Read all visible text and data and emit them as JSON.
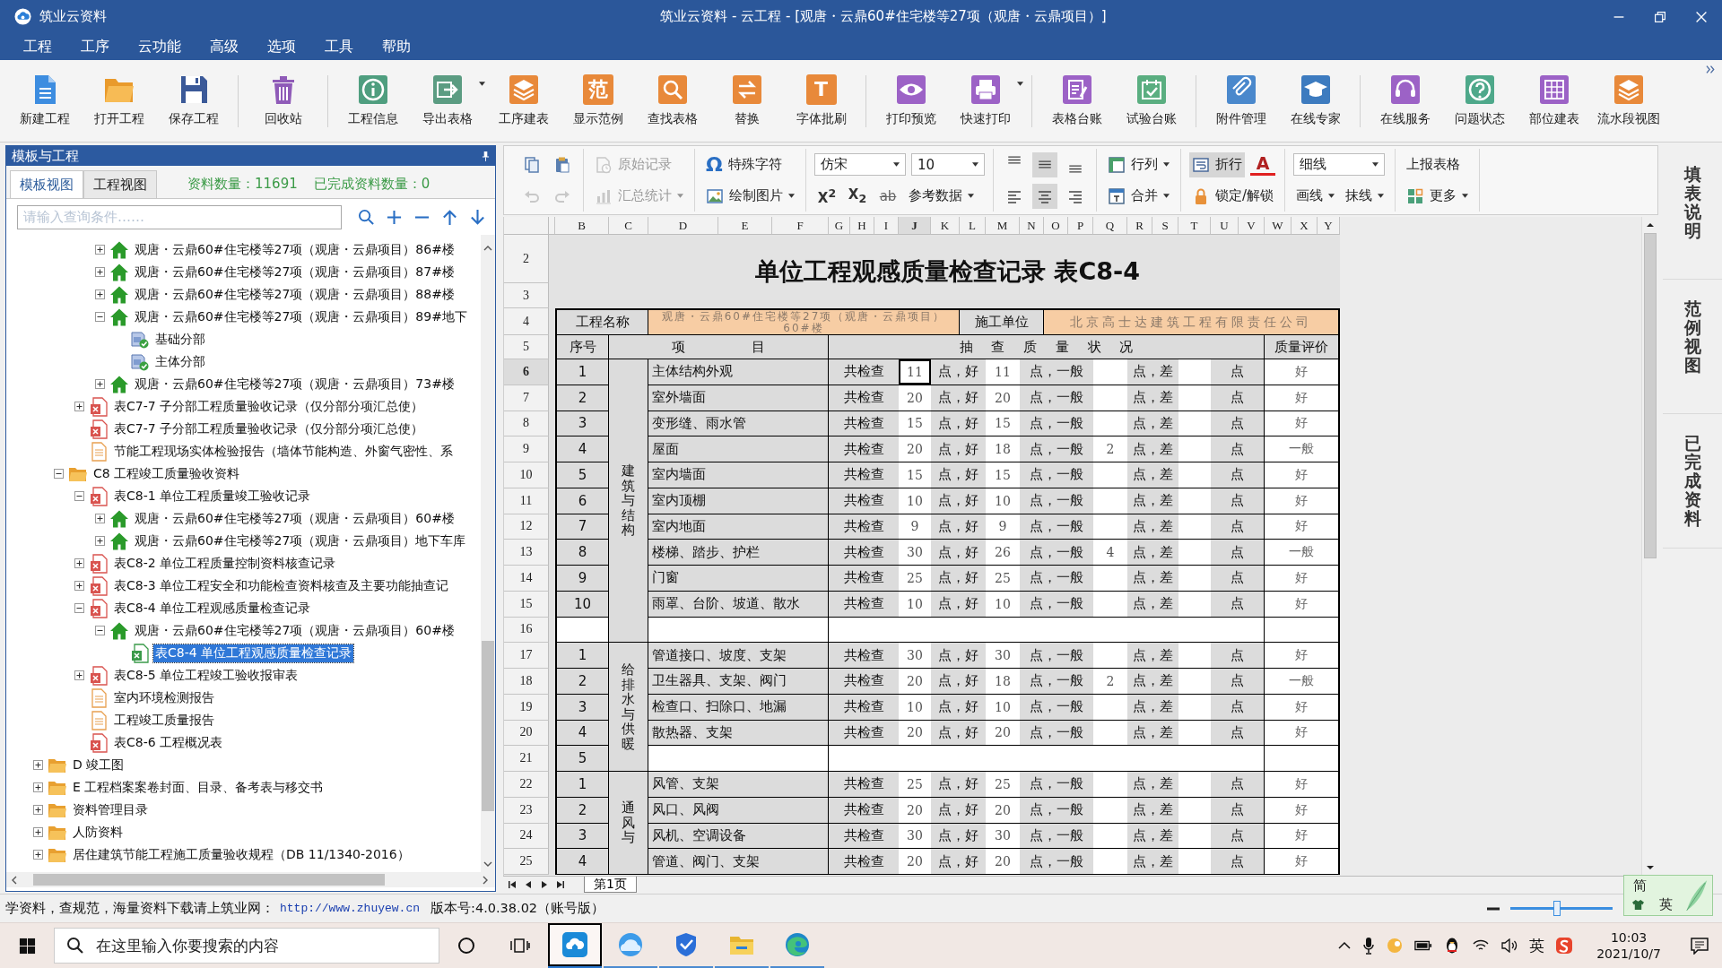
{
  "window": {
    "app_name": "筑业云资料",
    "title": "筑业云资料 - 云工程 - [观唐・云鼎60#住宅楼等27项（观唐・云鼎项目）]"
  },
  "menu": [
    "工程",
    "工序",
    "云功能",
    "高级",
    "选项",
    "工具",
    "帮助"
  ],
  "toolbar": {
    "groups": [
      [
        {
          "label": "新建工程",
          "menu": false
        },
        {
          "label": "打开工程",
          "menu": false
        },
        {
          "label": "保存工程",
          "menu": false
        }
      ],
      [
        {
          "label": "回收站",
          "menu": false
        }
      ],
      [
        {
          "label": "工程信息",
          "menu": false
        },
        {
          "label": "导出表格",
          "menu": true
        },
        {
          "label": "工序建表",
          "menu": false
        },
        {
          "label": "显示范例",
          "glyph": "范",
          "menu": false
        },
        {
          "label": "查找表格",
          "menu": false
        },
        {
          "label": "替换",
          "menu": false
        },
        {
          "label": "字体批刷",
          "glyph": "T",
          "menu": false
        }
      ],
      [
        {
          "label": "打印预览",
          "menu": false
        },
        {
          "label": "快速打印",
          "menu": true
        }
      ],
      [
        {
          "label": "表格台账",
          "menu": false
        },
        {
          "label": "试验台账",
          "menu": false
        }
      ],
      [
        {
          "label": "附件管理",
          "menu": false
        },
        {
          "label": "在线专家",
          "menu": false
        }
      ],
      [
        {
          "label": "在线服务",
          "menu": false
        },
        {
          "label": "问题状态",
          "menu": false
        },
        {
          "label": "部位建表",
          "menu": false
        },
        {
          "label": "流水段视图",
          "menu": false
        }
      ]
    ]
  },
  "format_toolbar": [
    {
      "top": [
        {
          "kind": "tool",
          "disabled": false,
          "pressed": false
        },
        {
          "kind": "tool",
          "disabled": false,
          "pressed": false
        }
      ],
      "bottom": [
        {
          "kind": "tool",
          "disabled": true,
          "pressed": false
        },
        {
          "kind": "tool",
          "disabled": true,
          "pressed": false
        }
      ]
    },
    {
      "top": [
        {
          "kind": "button",
          "label": "原始记录",
          "disabled": true,
          "pressed": false,
          "menu": false
        }
      ],
      "bottom": [
        {
          "kind": "button",
          "label": "汇总统计",
          "disabled": true,
          "pressed": false,
          "menu": true
        }
      ]
    },
    {
      "top": [
        {
          "kind": "button",
          "glyph": "Ω",
          "label": "特殊字符",
          "disabled": false,
          "pressed": false,
          "menu": false
        }
      ],
      "bottom": [
        {
          "kind": "button",
          "label": "绘制图片",
          "disabled": false,
          "pressed": false,
          "menu": true
        }
      ]
    },
    {
      "top": [
        {
          "kind": "dropdown",
          "value": "仿宋",
          "disabled": false,
          "pressed": false
        },
        {
          "kind": "dropdown",
          "value": "10",
          "disabled": false,
          "pressed": false
        }
      ],
      "bottom": [
        {
          "kind": "glyph",
          "glyph": "X$^{2}$",
          "disabled": false,
          "pressed": false
        },
        {
          "kind": "glyph",
          "glyph": "X$_{2}$",
          "disabled": false,
          "pressed": false
        },
        {
          "kind": "strike",
          "glyph": "ab",
          "disabled": false,
          "pressed": false
        },
        {
          "kind": "text",
          "label": "参考数据",
          "disabled": false,
          "pressed": false,
          "menu": true
        }
      ]
    },
    {
      "top": [
        {
          "kind": "tool",
          "disabled": false,
          "pressed": false
        },
        {
          "kind": "tool",
          "disabled": false,
          "pressed": true
        },
        {
          "kind": "tool",
          "disabled": false,
          "pressed": false
        }
      ],
      "bottom": [
        {
          "kind": "tool",
          "disabled": false,
          "pressed": false
        },
        {
          "kind": "tool",
          "disabled": false,
          "pressed": true
        },
        {
          "kind": "tool",
          "disabled": false,
          "pressed": false
        }
      ]
    },
    {
      "top": [
        {
          "kind": "button",
          "label": "行列",
          "disabled": false,
          "pressed": false,
          "menu": true
        }
      ],
      "bottom": [
        {
          "kind": "button",
          "label": "合并",
          "disabled": false,
          "pressed": false,
          "menu": true
        }
      ]
    },
    {
      "top": [
        {
          "kind": "button",
          "label": "折行",
          "disabled": false,
          "pressed": true,
          "menu": false
        },
        {
          "kind": "font-color",
          "glyph": "A",
          "disabled": false,
          "pressed": false
        }
      ],
      "bottom": [
        {
          "kind": "button",
          "label": "锁定/解锁",
          "disabled": false,
          "pressed": false,
          "menu": false
        }
      ]
    },
    {
      "top": [
        {
          "kind": "dropdown",
          "value": "细线",
          "disabled": false,
          "pressed": false
        }
      ],
      "bottom": [
        {
          "kind": "text",
          "label": "画线",
          "disabled": false,
          "pressed": false,
          "menu": true
        },
        {
          "kind": "text",
          "label": "抹线",
          "disabled": false,
          "pressed": false,
          "menu": true
        }
      ]
    },
    {
      "top": [
        {
          "kind": "text",
          "label": "上报表格",
          "disabled": false,
          "pressed": false,
          "menu": false
        }
      ],
      "bottom": [
        {
          "kind": "button",
          "label": "更多",
          "disabled": false,
          "pressed": false,
          "menu": true
        }
      ]
    }
  ],
  "panel": {
    "title": "模板与工程",
    "tabs": [
      {
        "label": "模板视图",
        "selected": true
      },
      {
        "label": "工程视图",
        "selected": false
      }
    ],
    "stats": [
      "资料数量：11691",
      "已完成资料数量：0"
    ],
    "search": {
      "placeholder": "请输入查询条件……"
    },
    "tree": [
      {
        "children": [
          {
            "children": [
              {
                "children": [
                  {
                    "label": "观唐・云鼎60#住宅楼等27项（观唐・云鼎项目）86#楼",
                    "kind": "building",
                    "expanded": false,
                    "selected": false
                  },
                  {
                    "label": "观唐・云鼎60#住宅楼等27项（观唐・云鼎项目）87#楼",
                    "kind": "building",
                    "expanded": false,
                    "selected": false
                  },
                  {
                    "label": "观唐・云鼎60#住宅楼等27项（观唐・云鼎项目）88#楼",
                    "kind": "building",
                    "expanded": false,
                    "selected": false
                  },
                  {
                    "label": "观唐・云鼎60#住宅楼等27项（观唐・云鼎项目）89#地下",
                    "kind": "building",
                    "expanded": true,
                    "selected": false,
                    "children": [
                      {
                        "label": "基础分部",
                        "kind": "division",
                        "selected": false
                      },
                      {
                        "label": "主体分部",
                        "kind": "division",
                        "selected": false
                      }
                    ]
                  },
                  {
                    "label": "观唐・云鼎60#住宅楼等27项（观唐・云鼎项目）73#楼",
                    "kind": "building",
                    "expanded": false,
                    "selected": false
                  }
                ]
              },
              {
                "label": "表C7-7 子分部工程质量验收记录（仅分部分项汇总使）",
                "kind": "form",
                "expanded": false,
                "selected": false
              },
              {
                "label": "表C7-7 子分部工程质量验收记录（仅分部分项汇总使）",
                "kind": "form",
                "selected": false
              },
              {
                "label": "节能工程现场实体检验报告（墙体节能构造、外窗气密性、系",
                "kind": "report",
                "selected": false
              }
            ]
          },
          {
            "label": "C8 工程竣工质量验收资料",
            "kind": "folder",
            "expanded": true,
            "selected": false,
            "children": [
              {
                "label": "表C8-1 单位工程质量竣工验收记录",
                "kind": "form",
                "expanded": true,
                "selected": false,
                "children": [
                  {
                    "label": "观唐・云鼎60#住宅楼等27项（观唐・云鼎项目）60#楼",
                    "kind": "building",
                    "expanded": false,
                    "selected": false
                  },
                  {
                    "label": "观唐・云鼎60#住宅楼等27项（观唐・云鼎项目）地下车库",
                    "kind": "building",
                    "expanded": false,
                    "selected": false
                  }
                ]
              },
              {
                "label": "表C8-2 单位工程质量控制资料核查记录",
                "kind": "form",
                "expanded": false,
                "selected": false
              },
              {
                "label": "表C8-3 单位工程安全和功能检查资料核查及主要功能抽查记",
                "kind": "form",
                "expanded": false,
                "selected": false
              },
              {
                "label": "表C8-4 单位工程观感质量检查记录",
                "kind": "form",
                "expanded": true,
                "selected": false,
                "children": [
                  {
                    "label": "观唐・云鼎60#住宅楼等27项（观唐・云鼎项目）60#楼",
                    "kind": "building",
                    "expanded": true,
                    "selected": false,
                    "children": [
                      {
                        "label": "表C8-4 单位工程观感质量检查记录",
                        "kind": "sheet",
                        "selected": true
                      }
                    ]
                  }
                ]
              },
              {
                "label": "表C8-5 单位工程竣工验收报审表",
                "kind": "form",
                "expanded": false,
                "selected": false
              },
              {
                "label": "室内环境检测报告",
                "kind": "report",
                "selected": false
              },
              {
                "label": "工程竣工质量报告",
                "kind": "report",
                "selected": false
              },
              {
                "label": "表C8-6 工程概况表",
                "kind": "form",
                "selected": false
              }
            ]
          }
        ]
      },
      {
        "label": "D 竣工图",
        "kind": "folder",
        "expanded": false,
        "selected": false
      },
      {
        "label": "E 工程档案案卷封面、目录、备考表与移交书",
        "kind": "folder",
        "expanded": false,
        "selected": false
      },
      {
        "label": "资料管理目录",
        "kind": "folder",
        "expanded": false,
        "selected": false
      },
      {
        "label": "人防资料",
        "kind": "folder",
        "expanded": false,
        "selected": false
      },
      {
        "label": "居住建筑节能工程施工质量验收规程（DB 11/1340-2016）",
        "kind": "folder",
        "expanded": false,
        "selected": false
      }
    ]
  },
  "sheet": {
    "columns": [
      {
        "label": "B",
        "selected": false
      },
      {
        "label": "C",
        "selected": false
      },
      {
        "label": "D",
        "selected": false
      },
      {
        "label": "E",
        "selected": false
      },
      {
        "label": "F",
        "selected": false
      },
      {
        "label": "G",
        "selected": false
      },
      {
        "label": "H",
        "selected": false
      },
      {
        "label": "I",
        "selected": false
      },
      {
        "label": "J",
        "selected": true
      },
      {
        "label": "K",
        "selected": false
      },
      {
        "label": "L",
        "selected": false
      },
      {
        "label": "M",
        "selected": false
      },
      {
        "label": "N",
        "selected": false
      },
      {
        "label": "O",
        "selected": false
      },
      {
        "label": "P",
        "selected": false
      },
      {
        "label": "Q",
        "selected": false
      },
      {
        "label": "R",
        "selected": false
      },
      {
        "label": "S",
        "selected": false
      },
      {
        "label": "T",
        "selected": false
      },
      {
        "label": "U",
        "selected": false
      },
      {
        "label": "V",
        "selected": false
      },
      {
        "label": "W",
        "selected": false
      },
      {
        "label": "X",
        "selected": false
      },
      {
        "label": "Y",
        "selected": false
      }
    ],
    "row_numbers": [
      {
        "label": "2",
        "selected": false
      },
      {
        "label": "3",
        "selected": false
      },
      {
        "label": "4",
        "selected": false
      },
      {
        "label": "5",
        "selected": false
      },
      {
        "label": "6",
        "selected": true
      },
      {
        "label": "7",
        "selected": false
      },
      {
        "label": "8",
        "selected": false
      },
      {
        "label": "9",
        "selected": false
      },
      {
        "label": "10",
        "selected": false
      },
      {
        "label": "11",
        "selected": false
      },
      {
        "label": "12",
        "selected": false
      },
      {
        "label": "13",
        "selected": false
      },
      {
        "label": "14",
        "selected": false
      },
      {
        "label": "15",
        "selected": false
      },
      {
        "label": "16",
        "selected": false
      },
      {
        "label": "17",
        "selected": false
      },
      {
        "label": "18",
        "selected": false
      },
      {
        "label": "19",
        "selected": false
      },
      {
        "label": "20",
        "selected": false
      },
      {
        "label": "21",
        "selected": false
      },
      {
        "label": "22",
        "selected": false
      },
      {
        "label": "23",
        "selected": false
      },
      {
        "label": "24",
        "selected": false
      },
      {
        "label": "25",
        "selected": false
      }
    ],
    "title": "单位工程观感质量检查记录 表C8-4",
    "header": {
      "project_label": "工程名称",
      "project_name": "观唐・云鼎60#住宅楼等27项（观唐・云鼎项目）60#楼",
      "builder_label": "施工单位",
      "builder_name": "北京高士达建筑工程有限责任公司",
      "no_label": "序号",
      "item_label": "项 目",
      "check_label": "抽 查 质 量 状 况",
      "rating_label": "质量评价"
    },
    "sections": [
      {
        "name": "建筑与结构",
        "rows": [
          {
            "kind": "item",
            "no": "1",
            "item": "主体结构外观",
            "total_label": "共检查",
            "total": "11",
            "good_label": "点，好",
            "good": "11",
            "fair_label": "点，一般",
            "poor_label": "点，差",
            "end_label": "点",
            "rating": "好"
          },
          {
            "kind": "item",
            "no": "2",
            "item": "室外墙面",
            "total_label": "共检查",
            "total": "20",
            "good_label": "点，好",
            "good": "20",
            "fair_label": "点，一般",
            "poor_label": "点，差",
            "end_label": "点",
            "rating": "好"
          },
          {
            "kind": "item",
            "no": "3",
            "item": "变形缝、雨水管",
            "total_label": "共检查",
            "total": "15",
            "good_label": "点，好",
            "good": "15",
            "fair_label": "点，一般",
            "poor_label": "点，差",
            "end_label": "点",
            "rating": "好"
          },
          {
            "kind": "item",
            "no": "4",
            "item": "屋面",
            "total_label": "共检查",
            "total": "20",
            "good_label": "点，好",
            "good": "18",
            "fair_label": "点，一般",
            "fair": "2",
            "poor_label": "点，差",
            "end_label": "点",
            "rating": "一般"
          },
          {
            "kind": "item",
            "no": "5",
            "item": "室内墙面",
            "total_label": "共检查",
            "total": "15",
            "good_label": "点，好",
            "good": "15",
            "fair_label": "点，一般",
            "poor_label": "点，差",
            "end_label": "点",
            "rating": "好"
          },
          {
            "kind": "item",
            "no": "6",
            "item": "室内顶棚",
            "total_label": "共检查",
            "total": "10",
            "good_label": "点，好",
            "good": "10",
            "fair_label": "点，一般",
            "poor_label": "点，差",
            "end_label": "点",
            "rating": "好"
          },
          {
            "kind": "item",
            "no": "7",
            "item": "室内地面",
            "total_label": "共检查",
            "total": "9",
            "good_label": "点，好",
            "good": "9",
            "fair_label": "点，一般",
            "poor_label": "点，差",
            "end_label": "点",
            "rating": "好"
          },
          {
            "kind": "item",
            "no": "8",
            "item": "楼梯、踏步、护栏",
            "total_label": "共检查",
            "total": "30",
            "good_label": "点，好",
            "good": "26",
            "fair_label": "点，一般",
            "fair": "4",
            "poor_label": "点，差",
            "end_label": "点",
            "rating": "一般"
          },
          {
            "kind": "item",
            "no": "9",
            "item": "门窗",
            "total_label": "共检查",
            "total": "25",
            "good_label": "点，好",
            "good": "25",
            "fair_label": "点，一般",
            "poor_label": "点，差",
            "end_label": "点",
            "rating": "好"
          },
          {
            "kind": "item",
            "no": "10",
            "item": "雨罩、台阶、坡道、散水",
            "total_label": "共检查",
            "total": "10",
            "good_label": "点，好",
            "good": "10",
            "fair_label": "点，一般",
            "poor_label": "点，差",
            "end_label": "点",
            "rating": "好"
          },
          {
            "kind": "blank"
          }
        ]
      },
      {
        "name": "给排水与供暖",
        "rows": [
          {
            "kind": "item",
            "no": "1",
            "item": "管道接口、坡度、支架",
            "total_label": "共检查",
            "total": "30",
            "good_label": "点，好",
            "good": "30",
            "fair_label": "点，一般",
            "poor_label": "点，差",
            "end_label": "点",
            "rating": "好"
          },
          {
            "kind": "item",
            "no": "2",
            "item": "卫生器具、支架、阀门",
            "total_label": "共检查",
            "total": "20",
            "good_label": "点，好",
            "good": "18",
            "fair_label": "点，一般",
            "fair": "2",
            "poor_label": "点，差",
            "end_label": "点",
            "rating": "一般"
          },
          {
            "kind": "item",
            "no": "3",
            "item": "检查口、扫除口、地漏",
            "total_label": "共检查",
            "total": "10",
            "good_label": "点，好",
            "good": "10",
            "fair_label": "点，一般",
            "poor_label": "点，差",
            "end_label": "点",
            "rating": "好"
          },
          {
            "kind": "item",
            "no": "4",
            "item": "散热器、支架",
            "total_label": "共检查",
            "total": "20",
            "good_label": "点，好",
            "good": "20",
            "fair_label": "点，一般",
            "poor_label": "点，差",
            "end_label": "点",
            "rating": "好"
          },
          {
            "kind": "blank",
            "no": "5"
          }
        ]
      },
      {
        "name": "通风与",
        "rows": [
          {
            "kind": "item",
            "no": "1",
            "item": "风管、支架",
            "total_label": "共检查",
            "total": "25",
            "good_label": "点，好",
            "good": "25",
            "fair_label": "点，一般",
            "poor_label": "点，差",
            "end_label": "点",
            "rating": "好"
          },
          {
            "kind": "item",
            "no": "2",
            "item": "风口、风阀",
            "total_label": "共检查",
            "total": "20",
            "good_label": "点，好",
            "good": "20",
            "fair_label": "点，一般",
            "poor_label": "点，差",
            "end_label": "点",
            "rating": "好"
          },
          {
            "kind": "item",
            "no": "3",
            "item": "风机、空调设备",
            "total_label": "共检查",
            "total": "30",
            "good_label": "点，好",
            "good": "30",
            "fair_label": "点，一般",
            "poor_label": "点，差",
            "end_label": "点",
            "rating": "好"
          },
          {
            "kind": "item",
            "no": "4",
            "item": "管道、阀门、支架",
            "total_label": "共检查",
            "total": "20",
            "good_label": "点，好",
            "good": "20",
            "fair_label": "点，一般",
            "poor_label": "点，差",
            "end_label": "点",
            "rating": "好"
          }
        ]
      }
    ],
    "tab": "第1页"
  },
  "side_tabs": [
    "填表说明",
    "范例视图",
    "已完成资料"
  ],
  "status_bar": {
    "text": "学资料，查规范，海量资料下载请上筑业网：",
    "link": "http://www.zhuyew.cn",
    "version": "版本号:4.0.38.02（账号版）",
    "zoom": {
      "level": 0.46
    }
  },
  "ime": {
    "mode": "简",
    "language": "英"
  },
  "taskbar": {
    "search": {
      "placeholder": "在这里输入你要搜索的内容"
    },
    "apps": [
      {
        "selected": true
      },
      {
        "selected": false
      },
      {
        "selected": false
      },
      {
        "selected": false
      },
      {
        "selected": false
      }
    ],
    "input_indicator": "英",
    "time": "10:03",
    "date": "2021/10/7"
  }
}
